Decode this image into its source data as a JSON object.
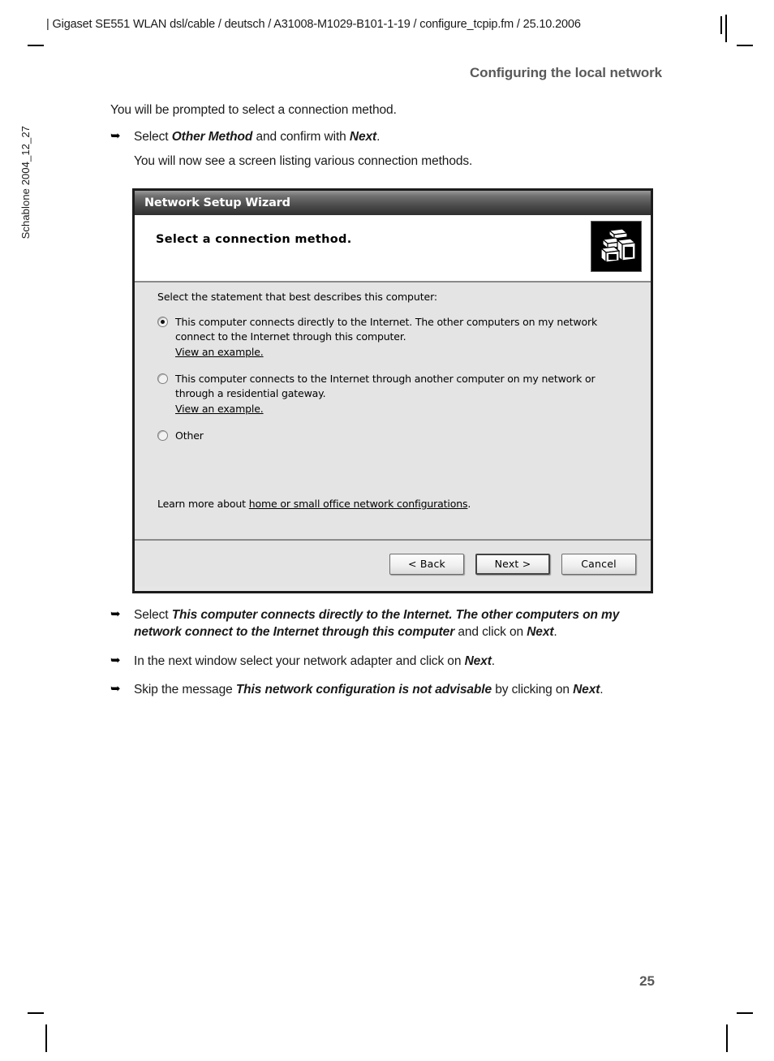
{
  "page": {
    "header_line": "| Gigaset SE551 WLAN dsl/cable / deutsch / A31008-M1029-B101-1-19 / configure_tcpip.fm / 25.10.2006",
    "section_title": "Configuring the local network",
    "margin_note": "Schablone 2004_12_27",
    "page_number": "25"
  },
  "intro": {
    "line1": "You will be prompted to select a connection method.",
    "bullet1_pre": "Select ",
    "bullet1_em1": "Other Method",
    "bullet1_mid": " and confirm with ",
    "bullet1_em2": "Next",
    "bullet1_end": ".",
    "line2": "You will now see a screen listing various connection methods."
  },
  "dialog": {
    "title": "Network Setup Wizard",
    "heading": "Select a connection method.",
    "icon_name": "two-computers-icon",
    "intro_text": "Select the statement that best describes this computer:",
    "options": [
      {
        "text": "This computer connects directly to the Internet. The other computers on my network connect to the Internet through this computer.",
        "link": "View an example.",
        "checked": true
      },
      {
        "text": "This computer connects to the Internet through another computer on my network or through a residential gateway.",
        "link": "View an example.",
        "checked": false
      },
      {
        "text": "Other",
        "link": "",
        "checked": false
      }
    ],
    "learn_prefix": "Learn more about ",
    "learn_link": "home or small office network configurations",
    "learn_suffix": ".",
    "buttons": {
      "back": "< Back",
      "next": "Next >",
      "cancel": "Cancel"
    }
  },
  "steps": [
    {
      "pre": "Select ",
      "em": "This computer connects directly to the Internet. The other computers on my network connect to the Internet through this computer",
      "mid": " and click on ",
      "em2": "Next",
      "end": "."
    },
    {
      "pre": "In the next window select your network adapter and click on ",
      "em": "",
      "mid": "",
      "em2": "Next",
      "end": "."
    },
    {
      "pre": "Skip the message ",
      "em": "This network configuration is not advisable",
      "mid": " by clicking on ",
      "em2": "Next",
      "end": "."
    }
  ],
  "icons": {
    "arrow": "➥"
  }
}
